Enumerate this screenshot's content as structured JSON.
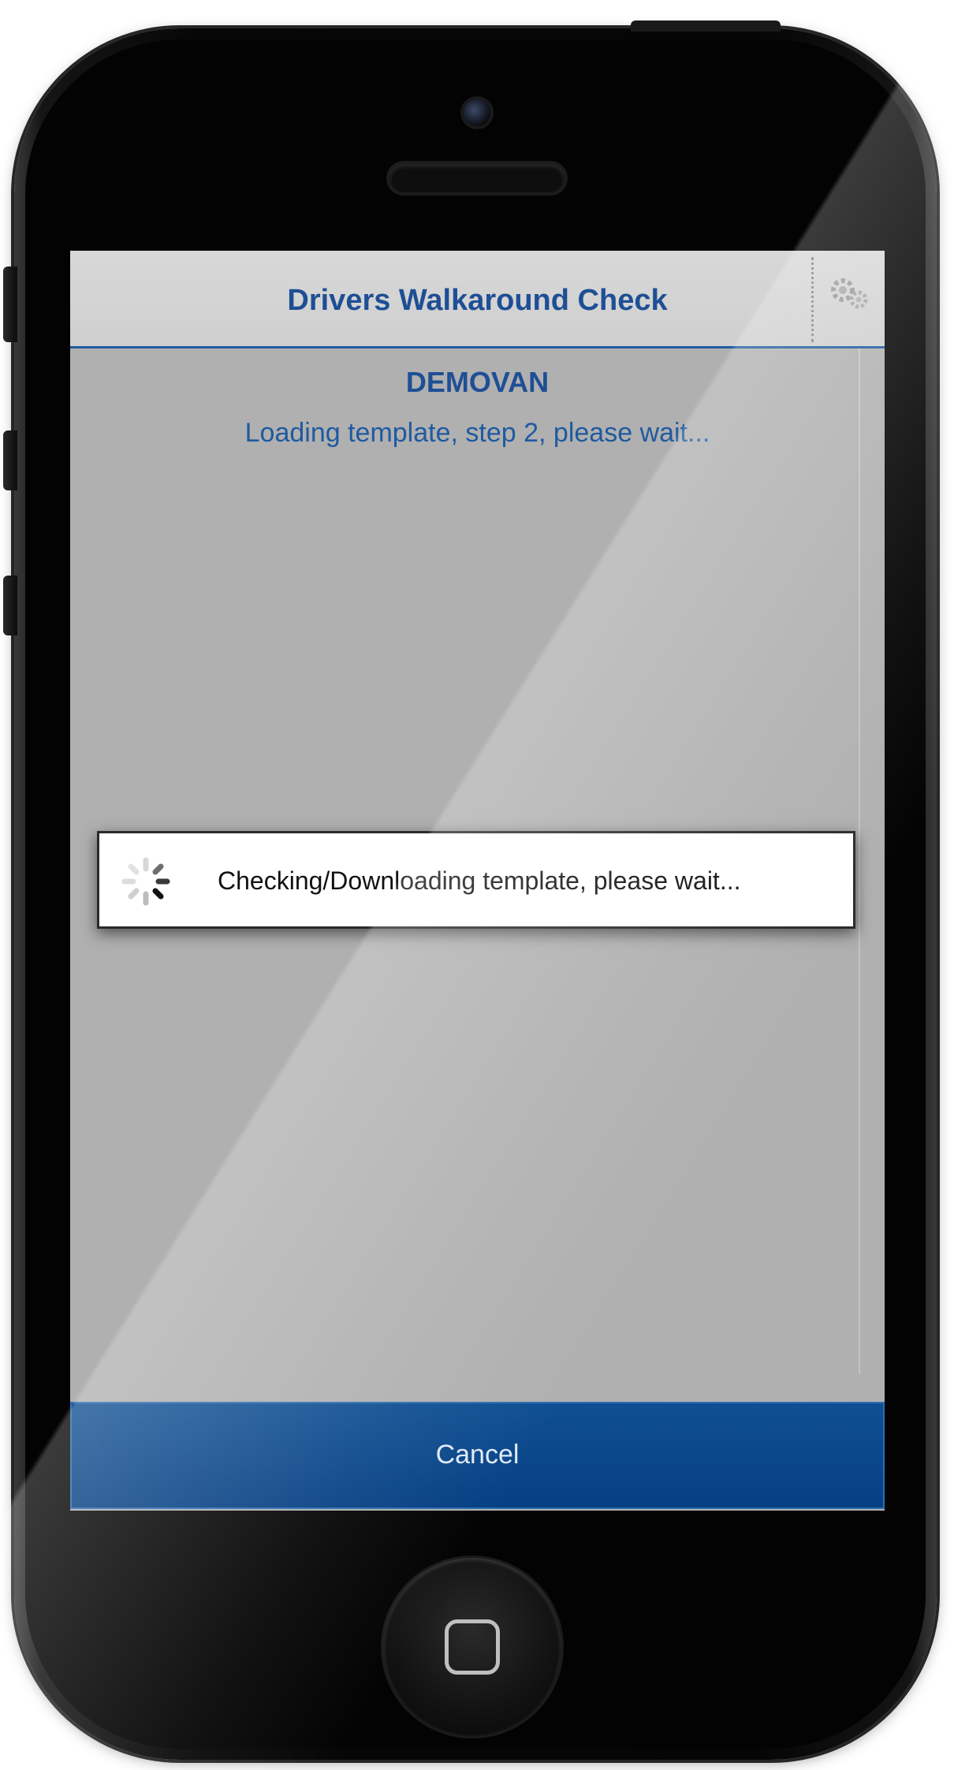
{
  "app": {
    "title": "Drivers Walkaround Check"
  },
  "main": {
    "vehicle": "DEMOVAN",
    "status": "Loading template, step 2, please wait..."
  },
  "dialog": {
    "message": "Checking/Downloading template, please wait...",
    "icon": "spinner-icon"
  },
  "footer": {
    "cancel_label": "Cancel"
  },
  "colors": {
    "accent": "#1e4f95",
    "cancel_bar": "#064083",
    "screen_bg": "#b0b0b0"
  },
  "icons": {
    "settings": "gear-icon",
    "home": "home-button-icon"
  }
}
